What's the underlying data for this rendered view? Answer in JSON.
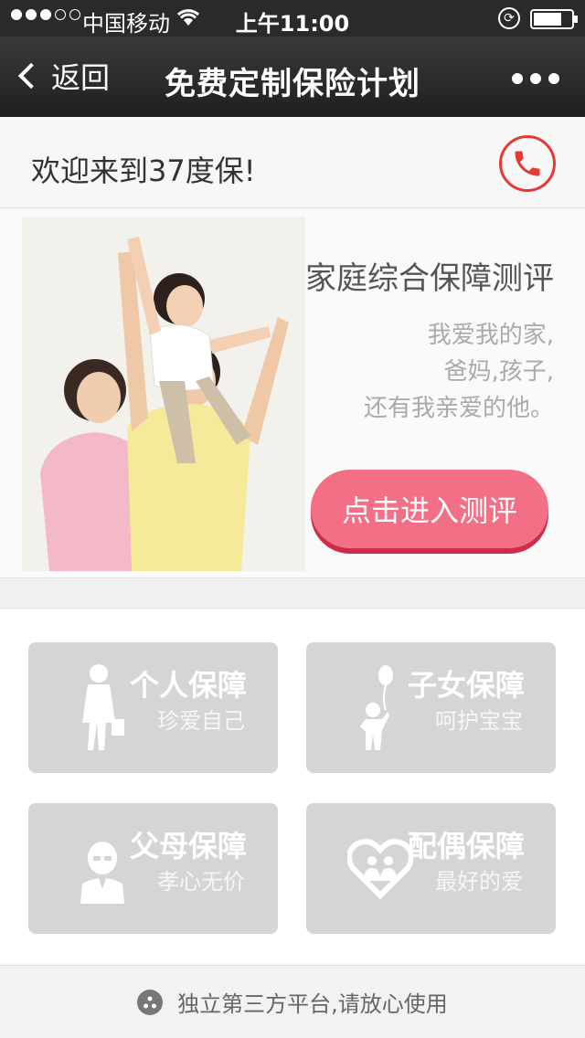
{
  "status_bar": {
    "carrier": "中国移动",
    "time": "上午11:00"
  },
  "nav": {
    "back_label": "返回",
    "title": "免费定制保险计划"
  },
  "welcome": {
    "text": "欢迎来到37度保!"
  },
  "hero": {
    "title": "家庭综合保障测评",
    "desc_line1": "我爱我的家,",
    "desc_line2": "爸妈,孩子,",
    "desc_line3": "还有我亲爱的他。",
    "cta_label": "点击进入测评"
  },
  "cards": [
    {
      "title": "个人保障",
      "subtitle": "珍爱自己",
      "icon": "woman-icon"
    },
    {
      "title": "子女保障",
      "subtitle": "呵护宝宝",
      "icon": "child-balloon-icon"
    },
    {
      "title": "父母保障",
      "subtitle": "孝心无价",
      "icon": "elder-icon"
    },
    {
      "title": "配偶保障",
      "subtitle": "最好的爱",
      "icon": "heart-couple-icon"
    }
  ],
  "footer": {
    "text": "独立第三方平台,请放心使用"
  },
  "colors": {
    "accent": "#f36f86",
    "phone_red": "#e53935",
    "card_bg": "#d6d5d5"
  }
}
